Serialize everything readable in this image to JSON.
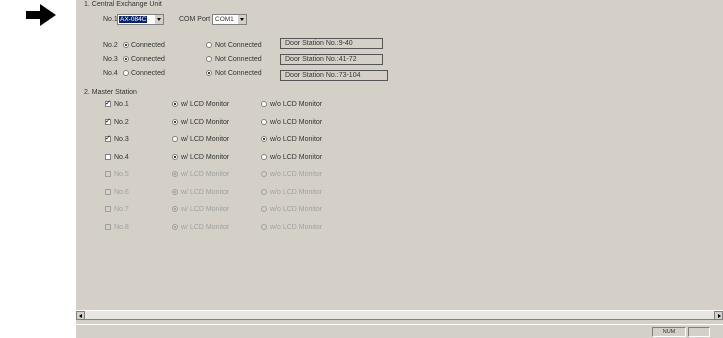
{
  "cx_title": "1. Central Exchange Unit",
  "no1_label": "No.1",
  "no1_value": "AX-084C",
  "com_label": "COM Port",
  "com_value": "COM1",
  "rows": [
    {
      "label": "No.2",
      "connected": "Connected",
      "not_connected": "Not Connected",
      "selected": "connected",
      "door": "Door Station No.:9-40"
    },
    {
      "label": "No.3",
      "connected": "Connected",
      "not_connected": "Not Connected",
      "selected": "connected",
      "door": "Door Station No.:41-72"
    },
    {
      "label": "No.4",
      "connected": "Connected",
      "not_connected": "Not Connected",
      "selected": "not_connected",
      "door": "Door Station No.:73-104"
    }
  ],
  "ms_title": "2. Master Station",
  "masters": [
    {
      "label": "No.1",
      "checked": true,
      "enabled": true,
      "lcd": "w/ LCD Monitor",
      "wo": "w/o LCD Monitor",
      "selected": "lcd"
    },
    {
      "label": "No.2",
      "checked": true,
      "enabled": true,
      "lcd": "w/ LCD Monitor",
      "wo": "w/o LCD Monitor",
      "selected": "lcd"
    },
    {
      "label": "No.3",
      "checked": true,
      "enabled": true,
      "lcd": "w/ LCD Monitor",
      "wo": "w/o LCD Monitor",
      "selected": "wo"
    },
    {
      "label": "No.4",
      "checked": false,
      "enabled": true,
      "lcd": "w/ LCD Monitor",
      "wo": "w/o LCD Monitor",
      "selected": "lcd"
    },
    {
      "label": "No.5",
      "checked": false,
      "enabled": false,
      "lcd": "w/ LCD Monitor",
      "wo": "w/o LCD Monitor",
      "selected": "lcd"
    },
    {
      "label": "No.6",
      "checked": false,
      "enabled": false,
      "lcd": "w/ LCD Monitor",
      "wo": "w/o LCD Monitor",
      "selected": "lcd"
    },
    {
      "label": "No.7",
      "checked": false,
      "enabled": false,
      "lcd": "w/ LCD Monitor",
      "wo": "w/o LCD Monitor",
      "selected": "lcd"
    },
    {
      "label": "No.8",
      "checked": false,
      "enabled": false,
      "lcd": "w/ LCD Monitor",
      "wo": "w/o LCD Monitor",
      "selected": "lcd"
    }
  ],
  "status_num": "NUM",
  "icons": {
    "pointer": "right-arrow-icon"
  }
}
